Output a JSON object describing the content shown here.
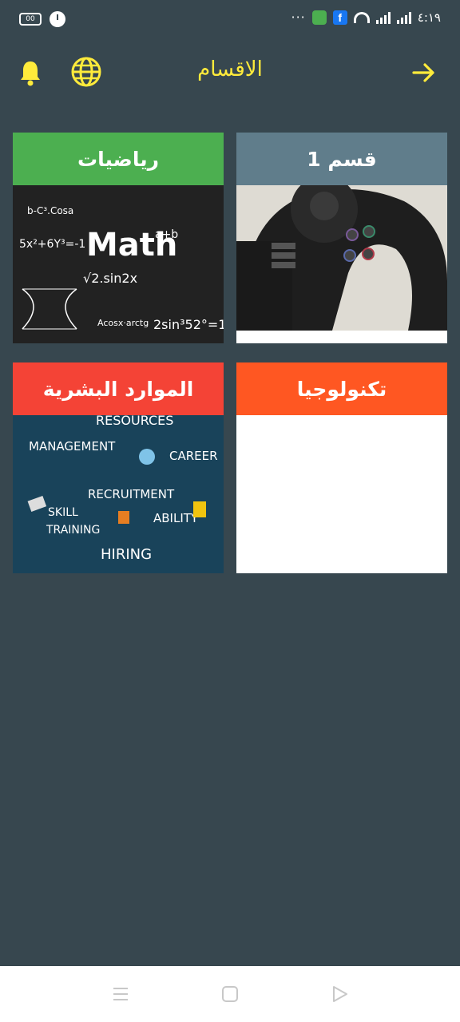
{
  "status_bar": {
    "time": "٤:١٩",
    "battery_label": "00",
    "dots": "···",
    "notification_fb": "f"
  },
  "app_bar": {
    "title": "الاقسام",
    "icons": [
      "bell-icon",
      "globe-icon",
      "arrow-right-icon"
    ],
    "accent_color": "#ffeb3b"
  },
  "categories": [
    {
      "label": "رياضيات",
      "header_color": "#4caf50",
      "image": "math-formulas"
    },
    {
      "label": "قسم 1",
      "header_color": "#607d8b",
      "image": "steering-wheel"
    },
    {
      "label": "الموارد البشرية",
      "header_color": "#f44336",
      "image": "human-resources"
    },
    {
      "label": "تكنولوجيا",
      "header_color": "#ff5722",
      "image": "blank"
    }
  ],
  "images": {
    "math": [
      "Math",
      "√2.sin2x",
      "5x²+6Y³=-1",
      "2sin³52°=1",
      "b-C³.Cosa",
      "a+b",
      "Acosx·arctg"
    ],
    "hr": [
      "RESOURCES",
      "MANAGEMENT",
      "CAREER",
      "RECRUITMENT",
      "SKILL",
      "TRAINING",
      "ABILITY",
      "HIRING"
    ]
  },
  "background_color": "#37474f"
}
